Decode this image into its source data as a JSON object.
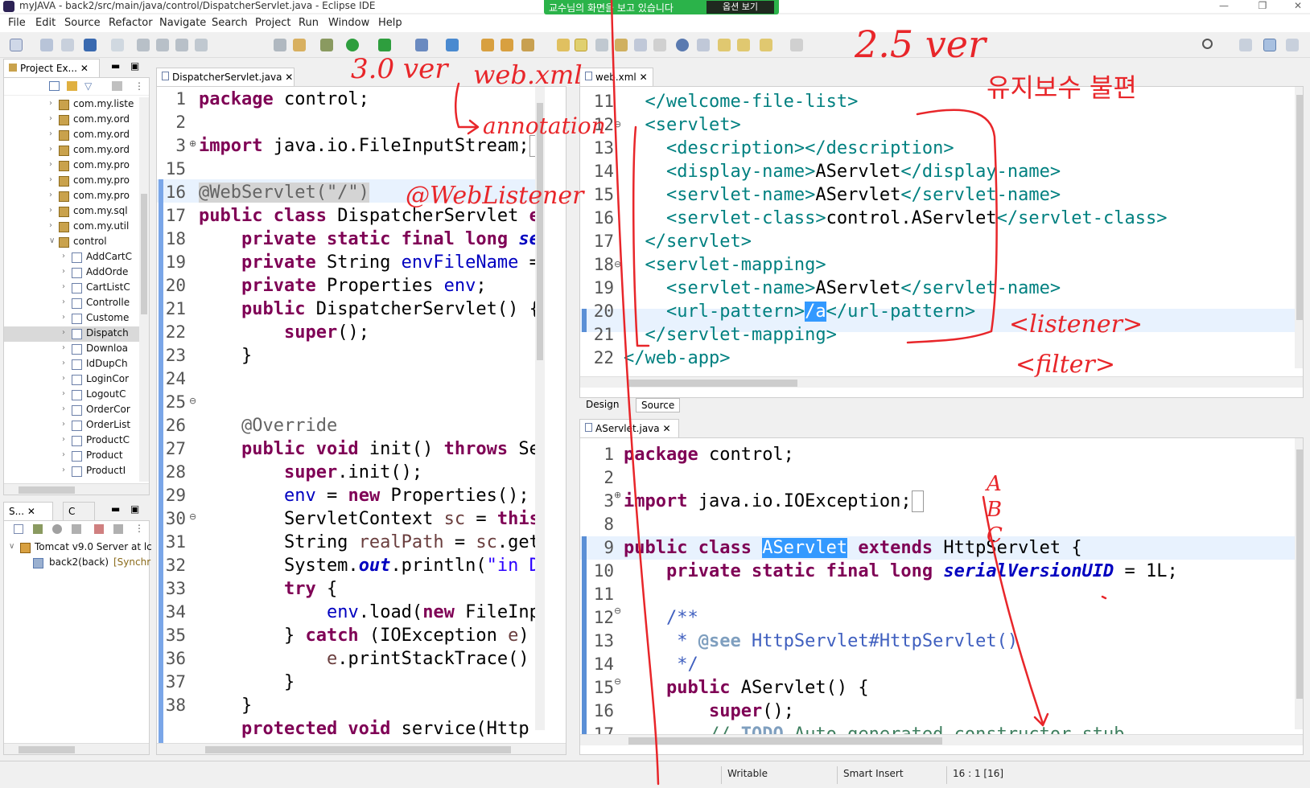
{
  "window": {
    "title": "myJAVA - back2/src/main/java/control/DispatcherServlet.java - Eclipse IDE"
  },
  "share_banner": {
    "message": "교수님의 화면을 보고 있습니다",
    "option": "옵션 보기"
  },
  "menu": [
    "File",
    "Edit",
    "Source",
    "Refactor",
    "Navigate",
    "Search",
    "Project",
    "Run",
    "Window",
    "Help"
  ],
  "project_explorer": {
    "tab": "Project Ex...",
    "items": [
      "com.my.liste",
      "com.my.ord",
      "com.my.ord",
      "com.my.ord",
      "com.my.pro",
      "com.my.pro",
      "com.my.pro",
      "com.my.sql",
      "com.my.util",
      "control",
      "AddCartC",
      "AddOrde",
      "CartListC",
      "Controlle",
      "Custome",
      "Dispatch",
      "Downloa",
      "IdDupCh",
      "LoginCor",
      "LogoutC",
      "OrderCor",
      "OrderList",
      "ProductC",
      "Product",
      "ProductI"
    ]
  },
  "servers": {
    "tab1": "S...",
    "tab2": "C",
    "server": "Tomcat v9.0 Server at lc",
    "module": "back2(back)",
    "module_status": "[Synchr"
  },
  "editor_left": {
    "tab": "DispatcherServlet.java",
    "line_numbers": [
      "1",
      "2",
      "3",
      "15",
      "16",
      "17",
      "18",
      "19",
      "20",
      "21",
      "22",
      "23",
      "24",
      "25",
      "26",
      "27",
      "28",
      "29",
      "30",
      "31",
      "32",
      "33",
      "34",
      "35",
      "36",
      "37",
      "38"
    ]
  },
  "editor_xml": {
    "tab": "web.xml",
    "line_numbers": [
      "11",
      "12",
      "13",
      "14",
      "15",
      "16",
      "17",
      "18",
      "19",
      "20",
      "21",
      "22"
    ],
    "bottom_tabs": [
      "Design",
      "Source"
    ]
  },
  "editor_aservlet": {
    "tab": "AServlet.java",
    "line_numbers": [
      "1",
      "2",
      "3",
      "8",
      "9",
      "10",
      "11",
      "12",
      "13",
      "14",
      "15",
      "16",
      "17"
    ]
  },
  "statusbar": {
    "mode": "Writable",
    "insert": "Smart Insert",
    "position": "16 : 1 [16]"
  },
  "handwriting": {
    "ver25": "2.5 ver",
    "ver30": "3.0 ver",
    "webxml": "web.xml",
    "annotation": "annotation",
    "weblistener": "@WebListener",
    "maintenance": "유지보수 불편",
    "listener": "<listener>",
    "filter": "<filter>",
    "letters": "A B C"
  },
  "colors": {
    "ink": "#e8262a",
    "banner": "#2bb34a",
    "selection": "#3399ff",
    "current_line": "#e8f2fe"
  }
}
